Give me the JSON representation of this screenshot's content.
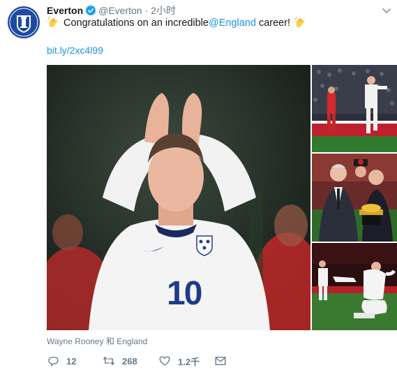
{
  "tweet": {
    "display_name": "Everton",
    "handle": "@Everton",
    "separator": "·",
    "time": "2小时",
    "text_before": "Congratulations on an incredible ",
    "mention": "@England",
    "text_after": " career!",
    "link": "bit.ly/2xc4l99",
    "media_caption": "Wayne Rooney 和 England",
    "player_number": "10",
    "replies": "12",
    "retweets": "268",
    "likes": "1.2千"
  },
  "icons": {
    "avatar": "everton-crest-icon",
    "verified": "verified-badge-icon",
    "caret": "chevron-down-icon",
    "clap": "clapping-hands-icon",
    "reply": "reply-icon",
    "retweet": "retweet-icon",
    "like": "heart-icon",
    "dm": "envelope-icon"
  },
  "colors": {
    "everton_blue": "#1f4aa0",
    "link_blue": "#1b95e0",
    "muted": "#657786",
    "verified": "#1da1f2"
  }
}
